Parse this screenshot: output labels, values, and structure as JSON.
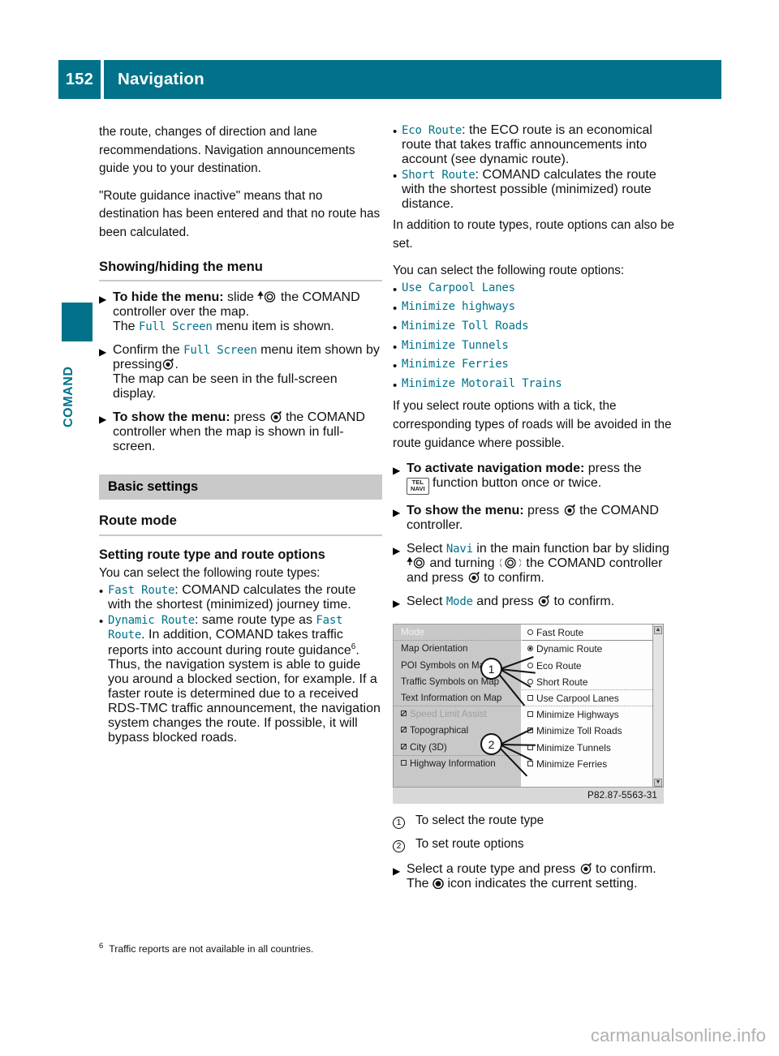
{
  "header": {
    "page_number": "152",
    "title": "Navigation"
  },
  "margin_tab": {
    "label": "COMAND"
  },
  "left_column": {
    "para_1": "the route, changes of direction and lane recommendations. Navigation announcements guide you to your destination.",
    "para_2": "\"Route guidance inactive\" means that no destination has been entered and that no route has been calculated.",
    "heading_showing_hiding": "Showing/hiding the menu",
    "step_hide": {
      "bold": "To hide the menu:",
      "text_a": "slide",
      "icon_slide": "comand-slide-up-icon",
      "text_b": "the COMAND controller over the map.",
      "sub_a": "The",
      "sub_term": "Full Screen",
      "sub_b": "menu item is shown."
    },
    "step_confirm": {
      "text_a": "Confirm the",
      "term": "Full Screen",
      "text_b": "menu item shown by pressing",
      "icon_press": "comand-press-icon",
      "text_c": ".",
      "sub": "The map can be seen in the full-screen display."
    },
    "step_show": {
      "bold": "To show the menu:",
      "text_a": "press",
      "icon_press": "comand-press-icon",
      "text_b": "the COMAND controller when the map is shown in full-screen."
    },
    "band_basic_settings": "Basic settings",
    "heading_route_mode": "Route mode",
    "subhead_setting": "Setting route type and route options",
    "intro_route_types": "You can select the following route types:",
    "route_type_bullets": [
      {
        "term": "Fast Route",
        "text": ": COMAND calculates the route with the shortest (minimized) journey time."
      },
      {
        "term": "Dynamic Route",
        "text_a": ": same route type as ",
        "term2": "Fast Route",
        "text_b": ". In addition, COMAND takes traffic reports into account during route guidance",
        "footnote_mark": "6",
        "text_c": ". Thus, the navigation system is able to guide you around a blocked section, for example. If a faster route is determined due to a received RDS-TMC traffic announcement, the navigation system changes the route. If possible, it will bypass blocked roads."
      }
    ]
  },
  "right_column": {
    "route_type_bullets": [
      {
        "term": "Eco Route",
        "text": ": the ECO route is an economical route that takes traffic announcements into account (see dynamic route)."
      },
      {
        "term": "Short Route",
        "text": ": COMAND calculates the route with the shortest possible (minimized) route distance."
      }
    ],
    "para_addition": "In addition to route types, route options can also be set.",
    "para_select_options": "You can select the following route options:",
    "route_option_bullets": [
      "Use Carpool Lanes",
      "Minimize highways",
      "Minimize Toll Roads",
      "Minimize Tunnels",
      "Minimize Ferries",
      "Minimize Motorail Trains"
    ],
    "para_tick": "If you select route options with a tick, the corresponding types of roads will be avoided in the route guidance where possible.",
    "step_activate": {
      "bold": "To activate navigation mode:",
      "text_a": "press the",
      "icon": {
        "name": "tel-navi-button-icon",
        "line1": "TEL",
        "line2": "NAVI"
      },
      "text_b": "function button once or twice."
    },
    "step_show_menu": {
      "bold": "To show the menu:",
      "text_a": "press",
      "icon_press": "comand-press-icon",
      "text_b": "the COMAND controller."
    },
    "step_select_navi": {
      "text_a": "Select",
      "term": "Navi",
      "text_b": "in the main function bar by sliding",
      "icon_slide": "comand-slide-up-icon",
      "text_c": "and turning",
      "icon_turn": "comand-turn-icon",
      "text_d": "the COMAND controller and press",
      "icon_press": "comand-press-icon",
      "text_e": "to confirm."
    },
    "step_select_mode": {
      "text_a": "Select",
      "term": "Mode",
      "text_b": "and press",
      "icon_press": "comand-press-icon",
      "text_c": "to confirm."
    },
    "figure": {
      "caption": "P82.87-5563-31",
      "callout_1": "1",
      "callout_2": "2",
      "left_panel": [
        {
          "label": "Mode",
          "style": "title"
        },
        {
          "label": "Map Orientation",
          "style": "normal"
        },
        {
          "label": "POI Symbols on Map",
          "style": "normal"
        },
        {
          "label": "Traffic Symbols on Map",
          "style": "normal"
        },
        {
          "label": "Text Information on Map",
          "style": "normal"
        },
        {
          "label": "Speed Limit Assist",
          "style": "dim",
          "mark": "checked"
        },
        {
          "label": "Topographical",
          "style": "normal",
          "mark": "checked"
        },
        {
          "label": "City (3D)",
          "style": "normal",
          "mark": "checked"
        },
        {
          "label": "Highway Information",
          "style": "normal",
          "mark": "empty"
        }
      ],
      "right_panel": [
        {
          "label": "Fast Route",
          "mark": "radio-empty"
        },
        {
          "label": "Dynamic Route",
          "mark": "radio-filled"
        },
        {
          "label": "Eco Route",
          "mark": "radio-empty"
        },
        {
          "label": "Short Route",
          "mark": "radio-empty"
        },
        {
          "label": "Use Carpool Lanes",
          "mark": "box-empty"
        },
        {
          "label": "Minimize Highways",
          "mark": "box-empty"
        },
        {
          "label": "Minimize Toll Roads",
          "mark": "box-empty"
        },
        {
          "label": "Minimize Tunnels",
          "mark": "box-empty"
        },
        {
          "label": "Minimize Ferries",
          "mark": "box-empty"
        }
      ]
    },
    "legend": [
      {
        "num": "1",
        "text": "To select the route type"
      },
      {
        "num": "2",
        "text": "To set route options"
      }
    ],
    "step_select_route_type": {
      "text_a": "Select a route type and press",
      "icon_press": "comand-press-icon",
      "text_b": "to confirm.",
      "sub_a": "The",
      "icon_dot": "filled-dot-icon",
      "sub_b": "icon indicates the current setting."
    }
  },
  "footnote": {
    "mark": "6",
    "text": "Traffic reports are not available in all countries."
  },
  "watermark": "carmanualsonline.info",
  "colors": {
    "accent_teal": "#017289",
    "band_gray": "#c9c9c9",
    "rule_gray": "#c9c9c9"
  }
}
